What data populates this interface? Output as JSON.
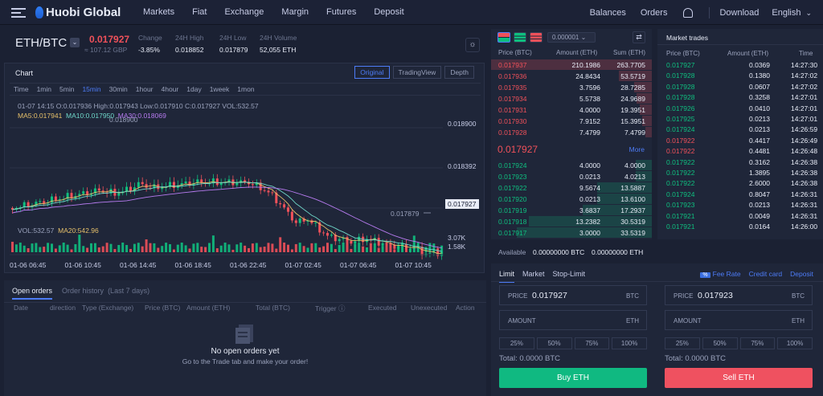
{
  "nav": {
    "brand": "Huobi Global",
    "left": [
      "Markets",
      "Fiat",
      "Exchange",
      "Margin",
      "Futures",
      "Deposit"
    ],
    "right": [
      "Balances",
      "Orders",
      "Download",
      "English"
    ]
  },
  "pair": {
    "name": "ETH/BTC",
    "price": "0.017927",
    "gbp": "≈ 107.12 GBP",
    "stats": [
      {
        "label": "Change",
        "value": "-3.85%"
      },
      {
        "label": "24H High",
        "value": "0.018852"
      },
      {
        "label": "24H Low",
        "value": "0.017879"
      },
      {
        "label": "24H Volume",
        "value": "52,055 ETH"
      }
    ]
  },
  "chart": {
    "title": "Chart",
    "tabs": [
      "Original",
      "TradingView",
      "Depth"
    ],
    "timeframes": [
      "Time",
      "1min",
      "5min",
      "15min",
      "30min",
      "1hour",
      "4hour",
      "1day",
      "1week",
      "1mon"
    ],
    "info": "01-07 14:15   O:0.017936  High:0.017943  Low:0.017910  C:0.017927  VOL:532.57",
    "ma5": "MA5:0.017941",
    "ma10": "MA10:0.017950",
    "ma30": "MA30:0.018069",
    "vol": "VOL:532.57",
    "ma20": "MA20:542.96"
  },
  "chart_data": {
    "type": "candlestick",
    "price_ticks": [
      "0.018900",
      "0.018392"
    ],
    "last_price": "0.017927",
    "high_mark": "0.018900",
    "low_mark": "0.017879",
    "vol_ticks": [
      "3.07K",
      "1.58K"
    ],
    "x_ticks": [
      "01-06 06:45",
      "01-06 10:45",
      "01-06 14:45",
      "01-06 18:45",
      "01-06 22:45",
      "01-07 02:45",
      "01-07 06:45",
      "01-07 10:45"
    ]
  },
  "orders": {
    "tabs": [
      "Open orders",
      "Order history",
      "(Last 7 days)"
    ],
    "columns": [
      "Date",
      "direction",
      "Type (Exchange)",
      "Price (BTC)",
      "Amount (ETH)",
      "Total (BTC)",
      "Trigger ⓘ",
      "Executed",
      "Unexecuted",
      "Action"
    ],
    "empty_title": "No open orders yet",
    "empty_sub": "Go to the Trade tab and make your order!"
  },
  "book": {
    "precision": "0.000001",
    "headers": [
      "Price (BTC)",
      "Amount (ETH)",
      "Sum (ETH)"
    ],
    "asks": [
      [
        "0.017937",
        "210.1986",
        "263.7705"
      ],
      [
        "0.017936",
        "24.8434",
        "53.5719"
      ],
      [
        "0.017935",
        "3.7596",
        "28.7285"
      ],
      [
        "0.017934",
        "5.5738",
        "24.9689"
      ],
      [
        "0.017931",
        "4.0000",
        "19.3951"
      ],
      [
        "0.017930",
        "7.9152",
        "15.3951"
      ],
      [
        "0.017928",
        "7.4799",
        "7.4799"
      ]
    ],
    "last": "0.017927",
    "more": "More",
    "bids": [
      [
        "0.017924",
        "4.0000",
        "4.0000"
      ],
      [
        "0.017923",
        "0.0213",
        "4.0213"
      ],
      [
        "0.017922",
        "9.5674",
        "13.5887"
      ],
      [
        "0.017920",
        "0.0213",
        "13.6100"
      ],
      [
        "0.017919",
        "3.6837",
        "17.2937"
      ],
      [
        "0.017918",
        "13.2382",
        "30.5319"
      ],
      [
        "0.017917",
        "3.0000",
        "33.5319"
      ]
    ],
    "available_label": "Available",
    "available_btc": "0.00000000 BTC",
    "available_eth": "0.00000000 ETH"
  },
  "trades": {
    "title": "Market trades",
    "headers": [
      "Price (BTC)",
      "Amount (ETH)",
      "Time"
    ],
    "rows": [
      [
        "0.017927",
        "0.0369",
        "14:27:30",
        "g"
      ],
      [
        "0.017928",
        "0.1380",
        "14:27:02",
        "g"
      ],
      [
        "0.017928",
        "0.0607",
        "14:27:02",
        "g"
      ],
      [
        "0.017928",
        "0.3258",
        "14:27:01",
        "g"
      ],
      [
        "0.017926",
        "0.0410",
        "14:27:01",
        "g"
      ],
      [
        "0.017925",
        "0.0213",
        "14:27:01",
        "g"
      ],
      [
        "0.017924",
        "0.0213",
        "14:26:59",
        "g"
      ],
      [
        "0.017922",
        "0.4417",
        "14:26:49",
        "r"
      ],
      [
        "0.017922",
        "0.4481",
        "14:26:48",
        "r"
      ],
      [
        "0.017922",
        "0.3162",
        "14:26:38",
        "g"
      ],
      [
        "0.017922",
        "1.3895",
        "14:26:38",
        "g"
      ],
      [
        "0.017922",
        "2.6000",
        "14:26:38",
        "g"
      ],
      [
        "0.017924",
        "0.8047",
        "14:26:31",
        "g"
      ],
      [
        "0.017923",
        "0.0213",
        "14:26:31",
        "g"
      ],
      [
        "0.017921",
        "0.0049",
        "14:26:31",
        "g"
      ],
      [
        "0.017921",
        "0.0164",
        "14:26:00",
        "g"
      ]
    ]
  },
  "trade": {
    "tabs": [
      "Limit",
      "Market",
      "Stop-Limit"
    ],
    "fee_badge": "%",
    "links": [
      "Fee Rate",
      "Credit card",
      "Deposit"
    ],
    "buy": {
      "price_label": "PRICE",
      "price": "0.017927",
      "price_unit": "BTC",
      "amount_label": "AMOUNT",
      "amount_unit": "ETH",
      "total": "Total: 0.0000 BTC",
      "button": "Buy ETH"
    },
    "sell": {
      "price_label": "PRICE",
      "price": "0.017923",
      "price_unit": "BTC",
      "amount_label": "AMOUNT",
      "amount_unit": "ETH",
      "total": "Total: 0.0000 BTC",
      "button": "Sell ETH"
    },
    "pcts": [
      "25%",
      "50%",
      "75%",
      "100%"
    ]
  },
  "colors": {
    "up": "#0fbf7f",
    "down": "#f0515a",
    "accent": "#4d7cf7"
  }
}
